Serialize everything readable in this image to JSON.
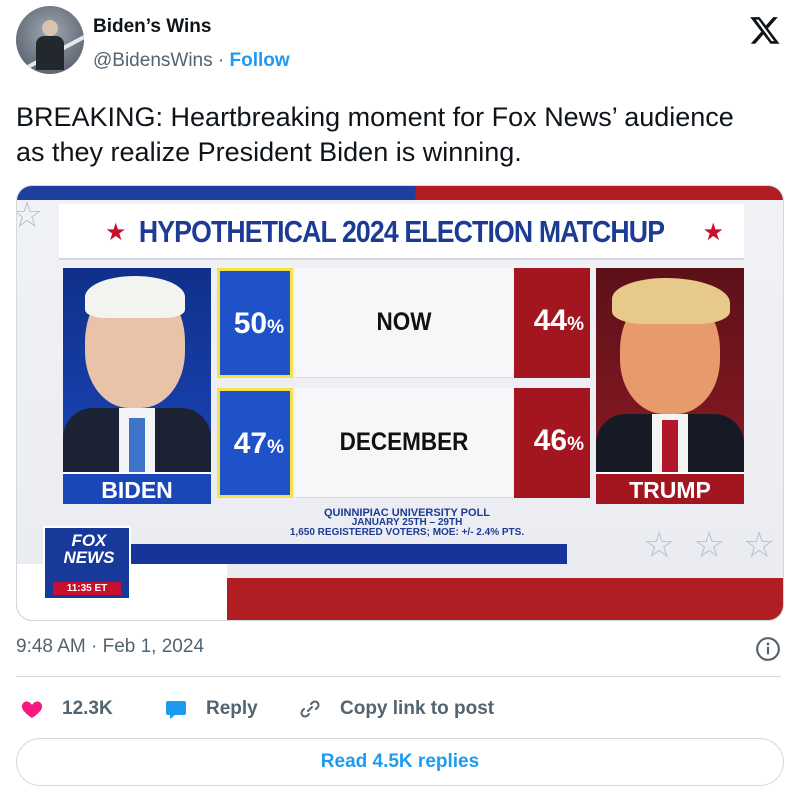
{
  "author": {
    "name": "Biden’s Wins",
    "handle": "@BidensWins",
    "separator": "·",
    "follow_label": "Follow"
  },
  "tweet": {
    "text": "BREAKING: Heartbreaking moment for Fox News’ audience as they realize President Biden is winning."
  },
  "media": {
    "title": "HYPOTHETICAL 2024 ELECTION MATCHUP",
    "left_candidate": "BIDEN",
    "right_candidate": "TRUMP",
    "rows": [
      {
        "label": "NOW",
        "left_value": "50",
        "right_value": "44",
        "unit": "%"
      },
      {
        "label": "DECEMBER",
        "left_value": "47",
        "right_value": "46",
        "unit": "%"
      }
    ],
    "poll_line1": "QUINNIPIAC UNIVERSITY POLL",
    "poll_line2": "JANUARY 25TH – 29TH",
    "poll_line3": "1,650 REGISTERED VOTERS; MOE: +/- 2.4% PTS.",
    "network_logo_text": "FOX NEWS",
    "network_time": "11:35 ET",
    "colors": {
      "blue": "#1f51c8",
      "red": "#a3151f"
    }
  },
  "meta": {
    "timestamp": "9:48 AM · Feb 1, 2024"
  },
  "actions": {
    "like_count": "12.3K",
    "reply_label": "Reply",
    "copy_label": "Copy link to post"
  },
  "read_replies_label": "Read 4.5K replies",
  "icons": [
    "x-logo-icon",
    "info-icon",
    "heart-icon",
    "reply-bubble-icon",
    "link-icon",
    "star-icon"
  ]
}
